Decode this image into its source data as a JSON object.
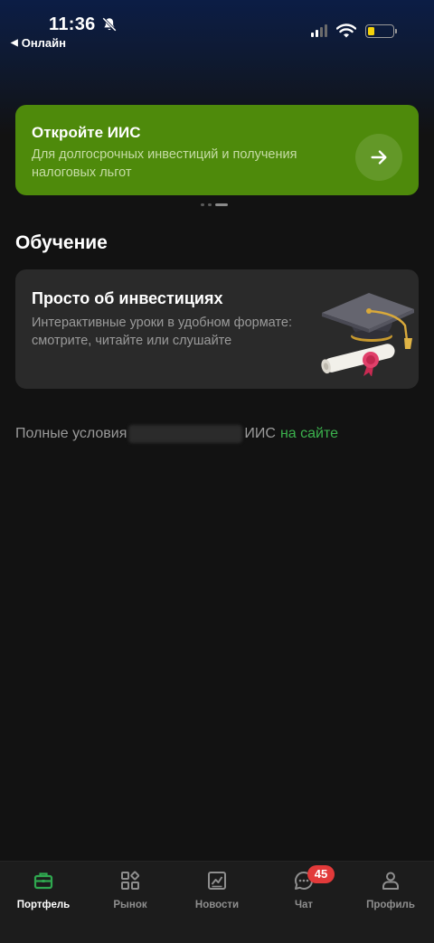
{
  "status_bar": {
    "time": "11:36",
    "back_label": "Онлайн",
    "battery_color": "#f5d20b"
  },
  "promo": {
    "title": "Откройте ИИС",
    "description": "Для долгосрочных инвестиций и получения налоговых льгот",
    "background_color": "#4e8a0b",
    "arrow_icon": "arrow-right-icon"
  },
  "carousel": {
    "pages": 3,
    "active": 2
  },
  "learning": {
    "section_title": "Обучение",
    "card_title": "Просто об инвестициях",
    "card_description": "Интерактивные уроки в удобном формате: смотрите, читайте или слушайте",
    "illustration_icon": "graduation-cap-diploma-icon"
  },
  "terms": {
    "prefix": "Полные условия",
    "suffix": "ИИС",
    "link_text": "на сайте",
    "link_color": "#3bb24d"
  },
  "tabbar": {
    "active_color": "#2fa84f",
    "items": [
      {
        "label": "Портфель",
        "icon": "briefcase-icon",
        "active": true
      },
      {
        "label": "Рынок",
        "icon": "market-grid-icon",
        "active": false
      },
      {
        "label": "Новости",
        "icon": "news-chart-icon",
        "active": false
      },
      {
        "label": "Чат",
        "icon": "chat-icon",
        "active": false,
        "badge": "45"
      },
      {
        "label": "Профиль",
        "icon": "profile-icon",
        "active": false
      }
    ]
  }
}
